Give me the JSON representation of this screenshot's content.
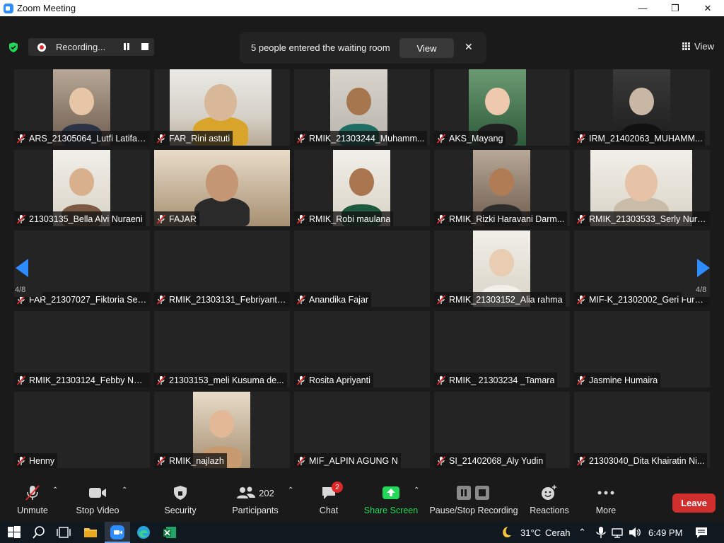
{
  "window": {
    "title": "Zoom Meeting"
  },
  "recording": {
    "label": "Recording..."
  },
  "notification": {
    "text": "5 people entered the waiting room",
    "view_label": "View"
  },
  "view_button": {
    "label": "View"
  },
  "pager": {
    "left_page": "4/8",
    "right_page": "4/8"
  },
  "participants": [
    {
      "name": "ARS_21305064_Lutfi Latifah...",
      "video": true
    },
    {
      "name": "FAR_Rini astuti",
      "video": true
    },
    {
      "name": "RMIK_21303244_Muhamm...",
      "video": true
    },
    {
      "name": "AKS_Mayang",
      "video": true
    },
    {
      "name": "IRM_21402063_MUHAMM...",
      "video": true
    },
    {
      "name": "21303135_Bella Alvi Nuraeni",
      "video": true
    },
    {
      "name": "FAJAR",
      "video": true
    },
    {
      "name": "RMIK_Robi maulana",
      "video": true
    },
    {
      "name": "RMIK_Rizki Haravani Darm...",
      "video": true
    },
    {
      "name": "RMIK_21303533_Serly Nury...",
      "video": true
    },
    {
      "name": "FAR_21307027_Fiktoria Ser...",
      "video": false
    },
    {
      "name": "RMIK_21303131_Febriyanti ...",
      "video": false
    },
    {
      "name": "Anandika Fajar",
      "video": false
    },
    {
      "name": "RMIK_21303152_Alia rahma",
      "video": true
    },
    {
      "name": "MIF-K_21302002_Geri Furni...",
      "video": false
    },
    {
      "name": "RMIK_21303124_Febby Nur...",
      "video": false
    },
    {
      "name": "21303153_meli Kusuma de...",
      "video": false
    },
    {
      "name": "Rosita Apriyanti",
      "video": false
    },
    {
      "name": "RMIK_ 21303234 _Tamara",
      "video": false
    },
    {
      "name": "Jasmine Humaira",
      "video": false
    },
    {
      "name": "Henny",
      "video": false
    },
    {
      "name": "RMIK_najlazh",
      "video": true
    },
    {
      "name": "MIF_ALPIN AGUNG N",
      "video": false
    },
    {
      "name": "SI_21402068_Aly Yudin",
      "video": false
    },
    {
      "name": "21303040_Dita Khairatin Ni...",
      "video": false
    }
  ],
  "toolbar": {
    "unmute": "Unmute",
    "stop_video": "Stop Video",
    "security": "Security",
    "participants": "Participants",
    "participants_count": "202",
    "chat": "Chat",
    "chat_badge": "2",
    "share_screen": "Share Screen",
    "pause_stop_recording": "Pause/Stop Recording",
    "reactions": "Reactions",
    "more": "More",
    "leave": "Leave"
  },
  "taskbar": {
    "weather_temp": "31°C",
    "weather_text": "Cerah",
    "time": "6:49 PM"
  },
  "colors": {
    "accent": "#2d8cff",
    "leave": "#d12e2e",
    "share": "#23d959",
    "muted": "#e02828"
  }
}
